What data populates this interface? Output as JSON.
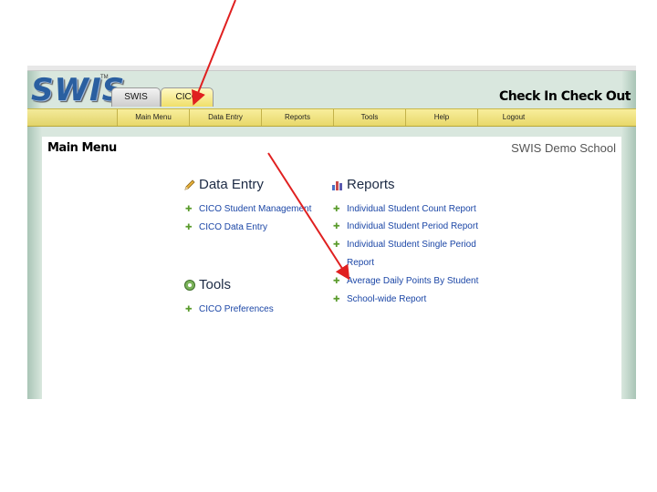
{
  "app": {
    "logo": "SWIS",
    "trademark": "TM",
    "title": "Check In Check Out",
    "tabs": [
      {
        "label": "SWIS"
      },
      {
        "label": "CICO"
      }
    ],
    "nav": [
      {
        "label": "Main Menu"
      },
      {
        "label": "Data Entry"
      },
      {
        "label": "Reports"
      },
      {
        "label": "Tools"
      },
      {
        "label": "Help"
      },
      {
        "label": "Logout"
      }
    ]
  },
  "panel": {
    "title": "Main Menu",
    "school": "SWIS Demo School"
  },
  "sections": {
    "data_entry": {
      "title": "Data Entry",
      "links": [
        "CICO Student Management",
        "CICO Data Entry"
      ]
    },
    "tools": {
      "title": "Tools",
      "links": [
        "CICO Preferences"
      ]
    },
    "reports": {
      "title": "Reports",
      "links": [
        "Individual Student Count Report",
        "Individual Student Period Report",
        "Individual Student Single Period",
        "Report",
        "Average Daily Points By Student",
        "School-wide Report"
      ]
    }
  },
  "colors": {
    "arrow": "#e02020",
    "link": "#1b46a6",
    "navbar": "#f0e27c",
    "cico_tab": "#f7ea8f",
    "frame": "#c8dbcf"
  }
}
